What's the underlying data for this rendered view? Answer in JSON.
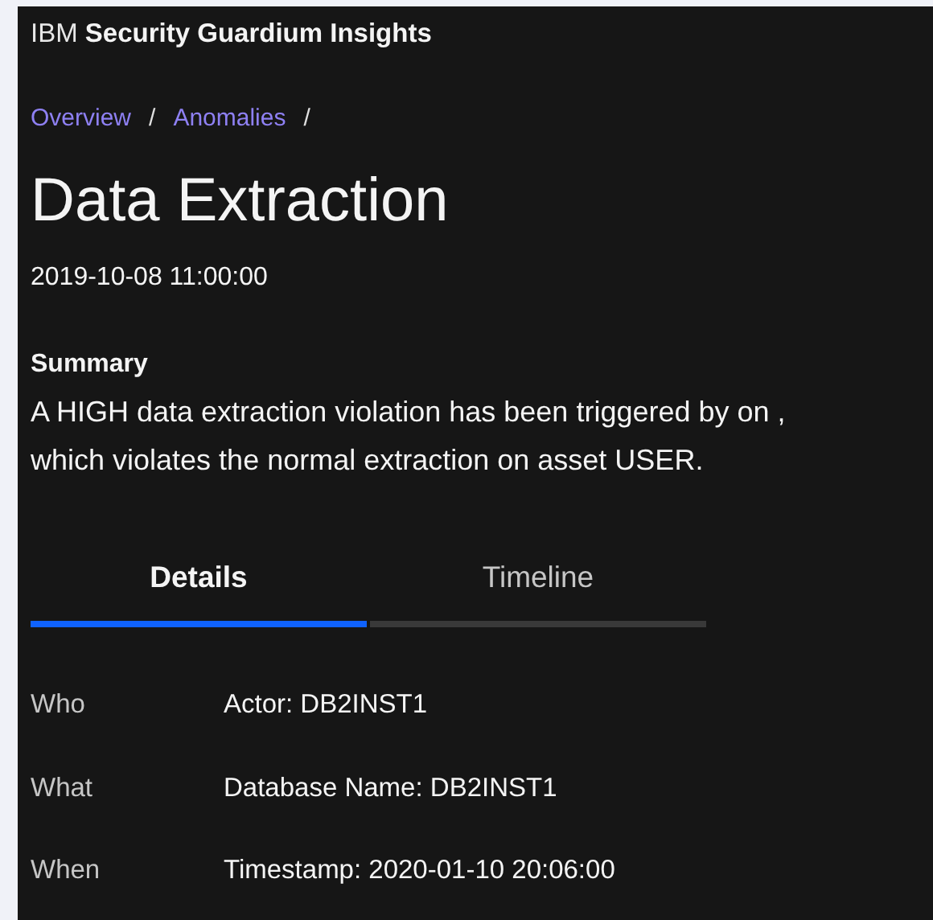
{
  "header": {
    "title": "IBM **Security Guardium Insights**"
  },
  "breadcrumbs": [
    {
      "label": "Overview",
      "separator": "/"
    },
    {
      "label": "Anomalies",
      "separator": "/"
    }
  ],
  "page": {
    "title": "Data Extraction",
    "timestamp": "2019-10-08 11:00:00"
  },
  "summary": {
    "heading": "Summary",
    "text": "A HIGH data extraction violation has been triggered by on , which violates the normal extraction on asset USER."
  },
  "tabs": [
    {
      "label": "Details",
      "selected": true
    },
    {
      "label": "Timeline",
      "selected": false
    }
  ],
  "details": [
    {
      "label": "Who",
      "value": "Actor: DB2INST1"
    },
    {
      "label": "What",
      "value": "Database Name: DB2INST1"
    },
    {
      "label": "When",
      "value": "Timestamp: 2020-01-10 20:06:00"
    }
  ]
}
